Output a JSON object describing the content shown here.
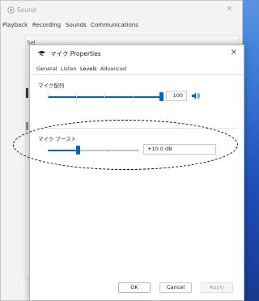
{
  "sound_window": {
    "title": "Sound",
    "close": "×",
    "tabs": [
      "Playback",
      "Recording",
      "Sounds",
      "Communications"
    ],
    "partial_label": "Sel"
  },
  "properties_dialog": {
    "title": "マイク Properties",
    "close": "×",
    "tabs": [
      "General",
      "Listen",
      "Levels",
      "Advanced"
    ],
    "active_tab": "Levels",
    "microphone_array": {
      "label": "マイク配列",
      "value": "100",
      "level": 1.0
    },
    "boost": {
      "label": "マイク ブースト",
      "value": "+10.0 dB",
      "level": 0.33
    },
    "buttons": {
      "ok": "OK",
      "cancel": "Cancel",
      "apply": "Apply"
    }
  },
  "colors": {
    "accent": "#0067c0",
    "annotation": "#000000"
  }
}
